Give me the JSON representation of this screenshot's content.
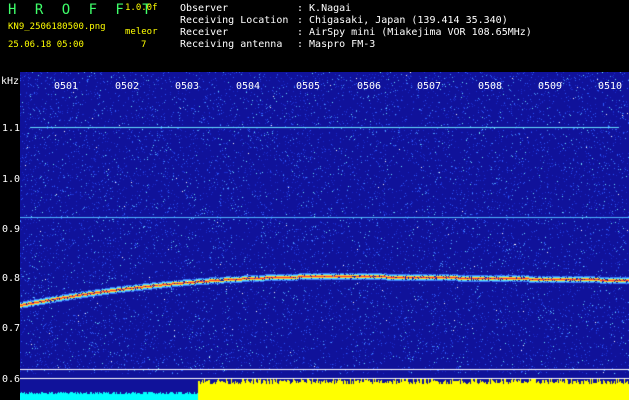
{
  "header": {
    "title": "H R O F F T",
    "version": "1.0.0f",
    "filename": "KN9_2506180500.png",
    "mode": "meleor",
    "timestamp": "25.06.18 05:00",
    "count": "7",
    "info": [
      {
        "label": "Observer",
        "value": ": K.Nagai"
      },
      {
        "label": "Receiving Location",
        "value": ": Chigasaki, Japan (139.414 35.340)"
      },
      {
        "label": "Receiver",
        "value": ": AirSpy mini (Miakejima VOR 108.65MHz)"
      },
      {
        "label": "Receiving antenna",
        "value": ": Maspro FM-3"
      }
    ]
  },
  "axis": {
    "unit": "kHz",
    "y_ticks": [
      "1.1",
      "1.0",
      "0.9",
      "0.8",
      "0.7",
      "0.6"
    ],
    "x_ticks": [
      "0501",
      "0502",
      "0503",
      "0504",
      "0505",
      "0506",
      "0507",
      "0508",
      "0509",
      "0510"
    ]
  },
  "colors": {
    "background": "#000000",
    "spectrum_bg": "#10129a",
    "trace": "#ff3b2a",
    "signal_line": "#66e0ff",
    "bar_left": "#00ffff",
    "bar_right": "#ffff00"
  }
}
